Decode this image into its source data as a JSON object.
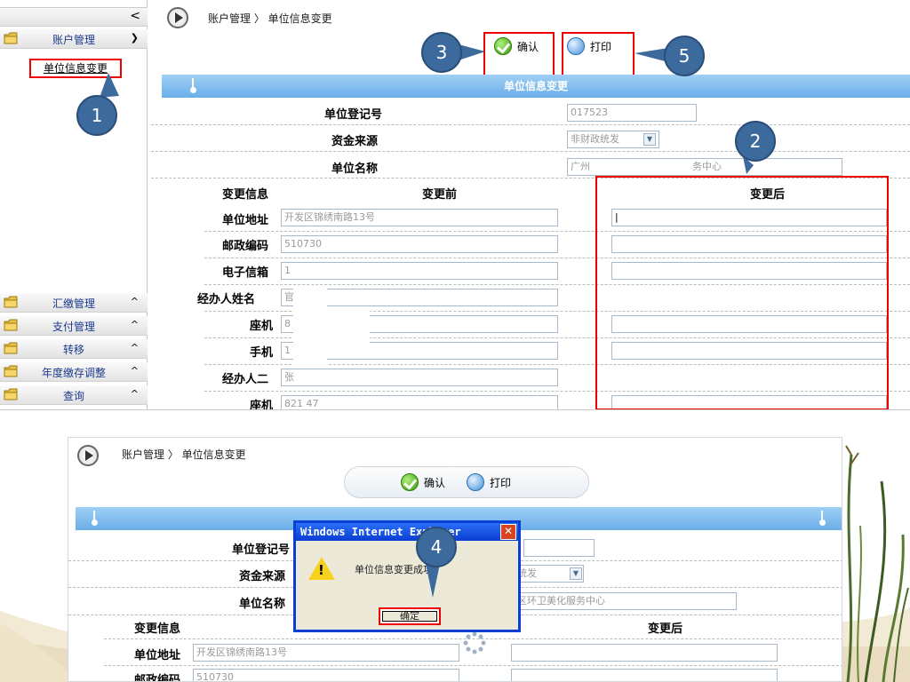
{
  "sidebar": {
    "collapse_glyph": "<",
    "sections": [
      {
        "label": "账户管理",
        "chevron": "expanded"
      },
      {
        "label": "汇缴管理",
        "chevron": "collapsed"
      },
      {
        "label": "支付管理",
        "chevron": "collapsed"
      },
      {
        "label": "转移",
        "chevron": "collapsed"
      },
      {
        "label": "年度缴存调整",
        "chevron": "collapsed"
      },
      {
        "label": "查询",
        "chevron": "collapsed"
      }
    ],
    "active_item": "单位信息变更"
  },
  "breadcrumb": "账户管理 〉 单位信息变更",
  "toolbar": {
    "confirm": "确认",
    "print": "打印"
  },
  "panel_title": "单位信息变更",
  "top_fields": [
    {
      "label": "单位登记号",
      "value": "017523"
    },
    {
      "label": "资金来源",
      "value": "非财政统发"
    },
    {
      "label": "单位名称",
      "value": "广州",
      "value_suffix": "务中心"
    }
  ],
  "change_table": {
    "headers": {
      "info": "变更信息",
      "before": "变更前",
      "after": "变更后"
    },
    "rows": [
      {
        "label": "单位地址",
        "before": "开发区锦绣南路13号"
      },
      {
        "label": "邮政编码",
        "before": "510730"
      },
      {
        "label": "电子信箱",
        "before": "1"
      },
      {
        "label": "经办人姓名",
        "before": "官"
      },
      {
        "label": "座机",
        "before": "8"
      },
      {
        "label": "手机",
        "before": "1"
      },
      {
        "label": "经办人二",
        "before": "张"
      },
      {
        "label": "座机",
        "before": "821    47"
      }
    ]
  },
  "callouts": [
    "1",
    "2",
    "3",
    "4",
    "5"
  ],
  "second": {
    "breadcrumb": "账户管理 〉 单位信息变更",
    "confirm": "确认",
    "print": "打印",
    "rows": [
      {
        "label": "单位登记号"
      },
      {
        "label": "资金来源",
        "value": "统发"
      },
      {
        "label": "单位名称",
        "value": "区环卫美化服务中心"
      }
    ],
    "headers": {
      "info": "变更信息",
      "after": "变更后"
    },
    "table_rows": [
      {
        "label": "单位地址",
        "before": "开发区锦绣南路13号"
      },
      {
        "label": "邮政编码",
        "before": "510730"
      }
    ],
    "dialog": {
      "title": "Windows Internet Explorer",
      "message": "单位信息变更成功!",
      "ok": "确定",
      "close": "✕"
    }
  }
}
